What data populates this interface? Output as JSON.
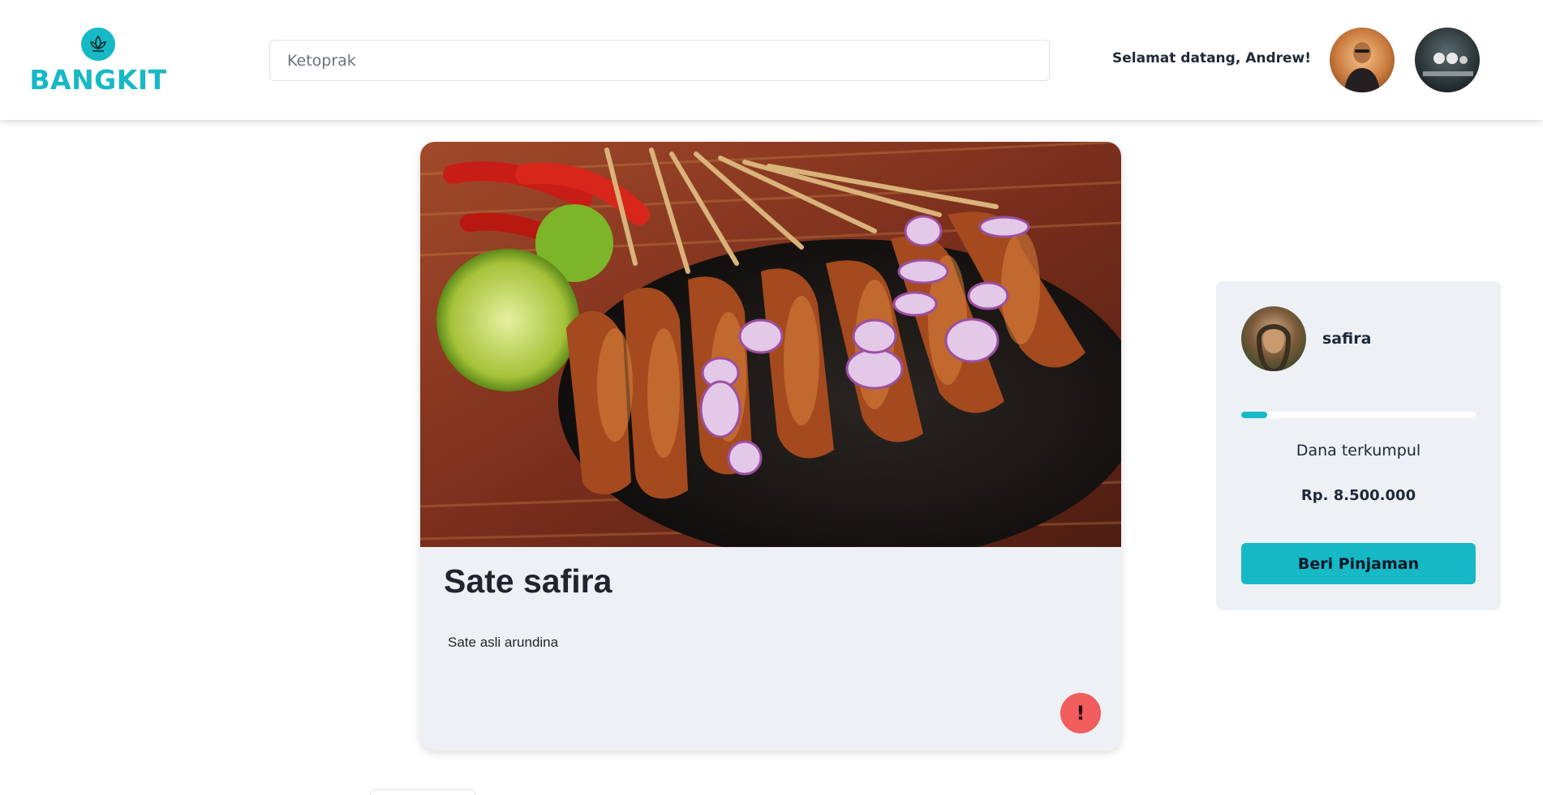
{
  "header": {
    "brand": "BANGKIT",
    "search": {
      "value": "",
      "placeholder": "Ketoprak"
    },
    "welcome_text": "Selamat datang, Andrew!"
  },
  "listing": {
    "title": "Sate safira",
    "description": "Sate asli arundina",
    "report_label": "!"
  },
  "panel": {
    "owner_name": "safira",
    "progress_percent": 11,
    "funds_label": "Dana terkumpul",
    "funds_amount": "Rp. 8.500.000",
    "lend_button_label": "Beri Pinjaman"
  },
  "colors": {
    "brand": "#16b9c5",
    "card_bg": "#edf1f5",
    "report": "#f25d5d"
  },
  "icons": {
    "logo": "leaf-icon",
    "report": "exclamation-icon"
  }
}
